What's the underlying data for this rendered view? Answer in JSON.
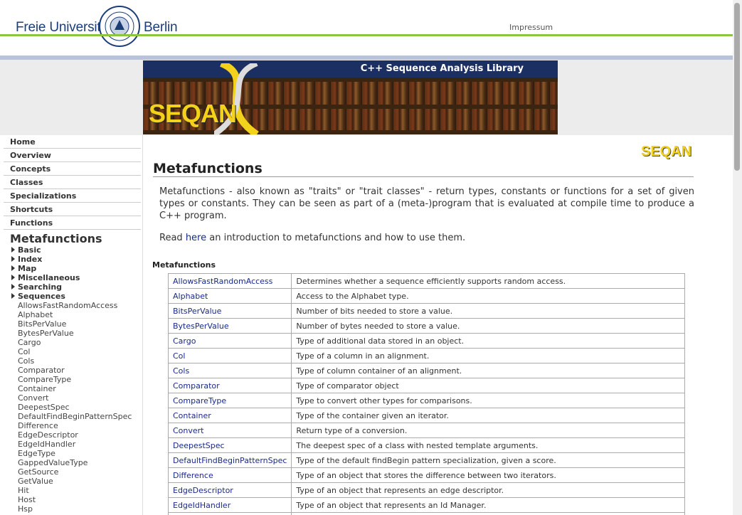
{
  "header": {
    "uni_left": "Freie Universität",
    "uni_right": "Berlin",
    "impressum": "Impressum"
  },
  "banner": {
    "title": "C++ Sequence Analysis Library",
    "logo_text": "SEQAN"
  },
  "nav": [
    {
      "label": "Home"
    },
    {
      "label": "Overview"
    },
    {
      "label": "Concepts"
    },
    {
      "label": "Classes"
    },
    {
      "label": "Specializations"
    },
    {
      "label": "Shortcuts"
    },
    {
      "label": "Functions"
    }
  ],
  "sidebar": {
    "title": "Metafunctions",
    "categories": [
      "Basic",
      "Index",
      "Map",
      "Miscellaneous",
      "Searching",
      "Sequences"
    ],
    "items": [
      "AllowsFastRandomAccess",
      "Alphabet",
      "BitsPerValue",
      "BytesPerValue",
      "Cargo",
      "Col",
      "Cols",
      "Comparator",
      "CompareType",
      "Container",
      "Convert",
      "DeepestSpec",
      "DefaultFindBeginPatternSpec",
      "Difference",
      "EdgeDescriptor",
      "EdgeIdHandler",
      "EdgeType",
      "GappedValueType",
      "GetSource",
      "GetValue",
      "Hit",
      "Host",
      "Hsp"
    ]
  },
  "main": {
    "logo_text": "SEQAN",
    "title": "Metafunctions",
    "intro": "Metafunctions - also known as \"traits\" or \"trait classes\" - return types, constants or functions for a set of given types or constants. They can be seen as part of a (meta-)program that is evaluated at compile time to produce a C++ program.",
    "read_prefix": "Read ",
    "read_link": "here",
    "read_suffix": " an introduction to metafunctions and how to use them.",
    "table_title": "Metafunctions",
    "rows": [
      {
        "name": "AllowsFastRandomAccess",
        "desc": "Determines whether a sequence efficiently supports random access."
      },
      {
        "name": "Alphabet",
        "desc": "Access to the Alphabet type."
      },
      {
        "name": "BitsPerValue",
        "desc": "Number of bits needed to store a value."
      },
      {
        "name": "BytesPerValue",
        "desc": "Number of bytes needed to store a value."
      },
      {
        "name": "Cargo",
        "desc": "Type of additional data stored in an object."
      },
      {
        "name": "Col",
        "desc": "Type of a column in an alignment."
      },
      {
        "name": "Cols",
        "desc": "Type of column container of an alignment."
      },
      {
        "name": "Comparator",
        "desc": "Type of comparator object"
      },
      {
        "name": "CompareType",
        "desc": "Type to convert other types for comparisons."
      },
      {
        "name": "Container",
        "desc": "Type of the container given an iterator."
      },
      {
        "name": "Convert",
        "desc": "Return type of a conversion."
      },
      {
        "name": "DeepestSpec",
        "desc": "The deepest spec of a class with nested template arguments."
      },
      {
        "name": "DefaultFindBeginPatternSpec",
        "desc": "Type of the default findBegin pattern specialization, given a score."
      },
      {
        "name": "Difference",
        "desc": "Type of an object that stores the difference between two iterators."
      },
      {
        "name": "EdgeDescriptor",
        "desc": "Type of an object that represents an edge descriptor."
      },
      {
        "name": "EdgeIdHandler",
        "desc": "Type of an object that represents an Id Manager."
      },
      {
        "name": "",
        "desc": ""
      }
    ]
  }
}
